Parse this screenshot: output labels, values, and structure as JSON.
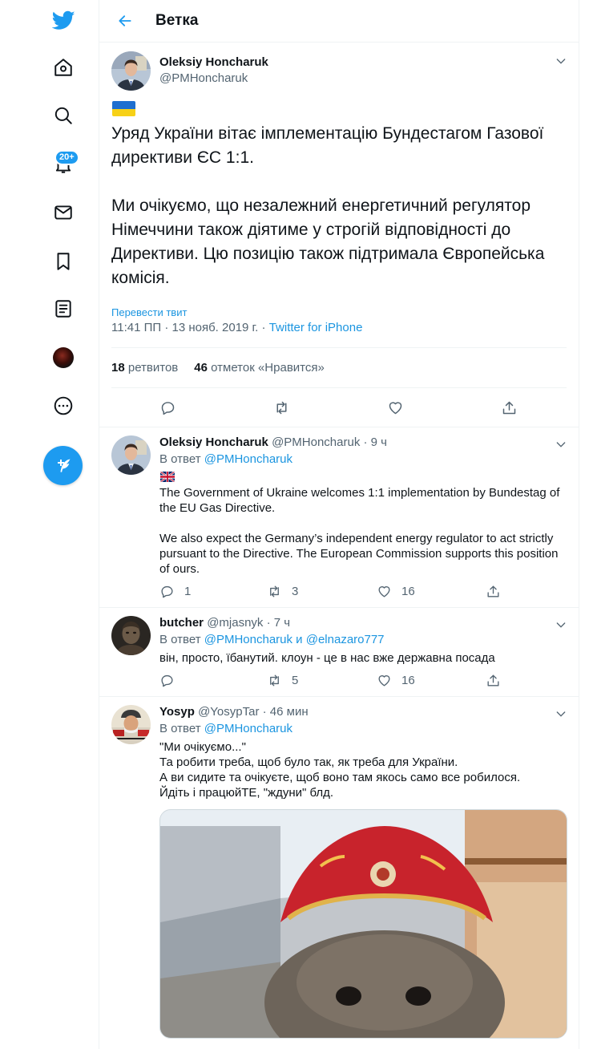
{
  "header": {
    "title": "Ветка"
  },
  "nav": {
    "notifications_badge": "20+"
  },
  "main_tweet": {
    "author_name": "Oleksiy Honcharuk",
    "author_handle": "@PMHoncharuk",
    "text": "Уряд України вітає імплементацію Бундестагом Газової директиви ЄС 1:1.\n\nМи очікуємо, що незалежний енергетичний регулятор Німеччини також діятиме у строгій відповідності до Директиви. Цю позицію також підтримала Європейська комісія.",
    "translate_label": "Перевести твит",
    "time": "11:41 ПП · 13 нояб. 2019 г. · ",
    "source": "Twitter for iPhone",
    "retweets_count": "18",
    "retweets_label": "ретвитов",
    "likes_count": "46",
    "likes_label": "отметок «Нравится»"
  },
  "replies": [
    {
      "name": "Oleksiy Honcharuk",
      "handle": "@PMHoncharuk",
      "time": " · 9 ч",
      "reply_prefix": "В ответ ",
      "reply_to": "@PMHoncharuk",
      "reply_extra": "",
      "text": "The Government of Ukraine welcomes 1:1 implementation by Bundestag of the EU Gas Directive.\n\nWe also expect the Germany’s independent energy regulator to act strictly pursuant to the Directive. The European Commission supports this position of ours.",
      "replies": "1",
      "retweets": "3",
      "likes": "16"
    },
    {
      "name": "butcher",
      "handle": "@mjasnyk",
      "time": " · 7 ч",
      "reply_prefix": "В ответ ",
      "reply_to": "@PMHoncharuk и @elnazaro777",
      "text": "він, просто, їбанутий. клоун - це в нас вже державна посада",
      "replies": "",
      "retweets": "5",
      "likes": "16"
    },
    {
      "name": "Yosyp",
      "handle": "@YosypTar",
      "time": " · 46 мин",
      "reply_prefix": "В ответ ",
      "reply_to": "@PMHoncharuk",
      "text": "\"Ми очікуємо...\"\nТа робити треба, щоб було так, як треба для України.\nА ви сидите та очікуєте, щоб воно там  якось само все робилося.\nЙдіть і працюйТЕ, \"ждуни\" блд."
    }
  ],
  "colors": {
    "accent": "#1d9bf0",
    "link": "#1b95e0",
    "muted": "#536471"
  }
}
